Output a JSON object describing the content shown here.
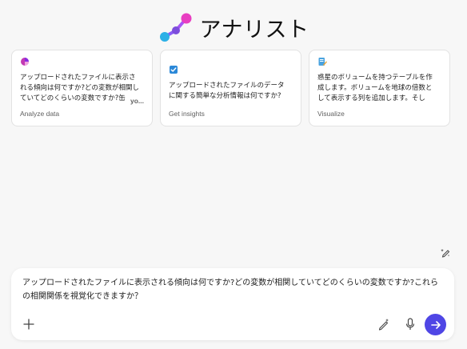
{
  "header": {
    "title": "アナリスト",
    "logo_icon": "analyst-molecule-logo"
  },
  "cards": [
    {
      "icon": "chart-pie-icon",
      "icon_color": "#c239b3",
      "text": "アップロードされたファイルに表示される傾向は何ですか?どの変数が相関していてどのくらいの変数ですか?缶",
      "more": "yo...",
      "category": "Analyze data"
    },
    {
      "icon": "checkbox-icon",
      "icon_color": "#2b88d8",
      "text": "アップロードされたファイルのデータに関する簡単な分析情報は何ですか?",
      "category": "Get insights"
    },
    {
      "icon": "document-edit-icon",
      "icon_color": "#e8a53a",
      "text": "惑星のボリュームを持つテーブルを作成します。ボリュームを地球の倍数として表示する列を追加します。そして...",
      "category": "Visualize"
    }
  ],
  "composer": {
    "text": "アップロードされたファイルに表示される傾向は何ですか?どの変数が相関していてどのくらいの変数ですか?これらの相関関係を視覚化できますか？"
  },
  "colors": {
    "accent": "#4f46e5",
    "background": "#f7f7f7"
  }
}
